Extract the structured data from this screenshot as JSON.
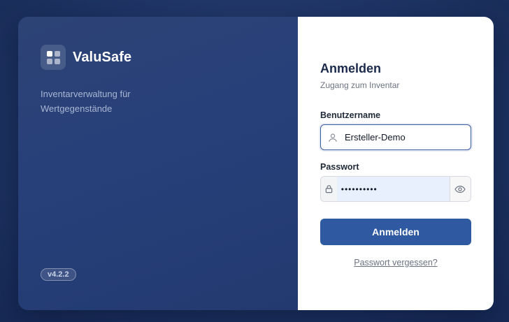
{
  "brand": {
    "name": "ValuSafe",
    "tagline": "Inventarverwaltung für Wertgegenstände",
    "version": "v4.2.2"
  },
  "login": {
    "title": "Anmelden",
    "subtitle": "Zugang zum Inventar",
    "username_label": "Benutzername",
    "username_value": "Ersteller-Demo",
    "password_label": "Passwort",
    "password_value": "••••••••••",
    "submit_label": "Anmelden",
    "forgot_label": "Passwort vergessen?"
  },
  "icons": {
    "logo": "grid-logo-icon",
    "username": "user-icon",
    "password": "lock-icon",
    "reveal": "eye-icon"
  },
  "colors": {
    "accent": "#2f5aa2",
    "panel_dark": "#27407a",
    "background": "#1f3566"
  }
}
